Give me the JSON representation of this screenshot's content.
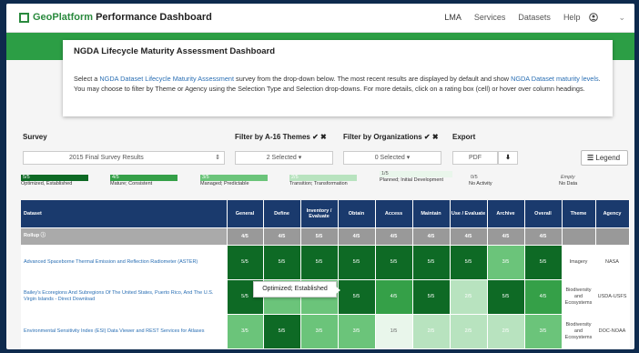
{
  "app": {
    "title_prefix": "GeoPlatform",
    "title_rest": " Performance Dashboard"
  },
  "nav": {
    "items": [
      "LMA",
      "Services",
      "Datasets",
      "Help"
    ],
    "user_caret": "⌄"
  },
  "panel": {
    "title": "NGDA Lifecycle Maturity Assessment Dashboard",
    "p1": "Select a ",
    "link1": "NGDA Dataset Lifecycle Maturity Assessment",
    "p2": " survey from the drop-down below. The most recent results are displayed by default and show ",
    "link2": "NGDA Dataset maturity levels",
    "p3": ". You may choose to filter by Theme or Agency using the Selection Type and Selection drop-downs. For more details, click on a rating box (cell) or hover over column headings."
  },
  "controls": {
    "survey_label": "Survey",
    "survey_value": "2015 Final Survey Results",
    "themes_label": "Filter by A-16 Themes",
    "themes_value": "2 Selected",
    "orgs_label": "Filter by Organizations",
    "orgs_value": "0 Selected",
    "export_label": "Export",
    "export_value": "PDF",
    "legend_button": "Legend",
    "check": "✔",
    "x": "✖",
    "caret": "▾",
    "updown": "⇕",
    "down": "⬇"
  },
  "legend": [
    {
      "score": "5/5",
      "text": "Optimized, Established",
      "color": "#0e6a25"
    },
    {
      "score": "4/5",
      "text": "Mature; Consistent",
      "color": "#35a048"
    },
    {
      "score": "3/5",
      "text": "Managed; Predictable",
      "color": "#6bc47a"
    },
    {
      "score": "2/5",
      "text": "Transition; Transformation",
      "color": "#b8e3bf"
    },
    {
      "score": "1/5",
      "text": "Planned; Initial Development",
      "color": "#e9f6eb"
    },
    {
      "score": "0/5",
      "text": "No Activity",
      "color": "#ffffff"
    },
    {
      "score": "Empty",
      "text": "No Data",
      "color": "#f5f5f5"
    }
  ],
  "table": {
    "headers": [
      "Dataset",
      "General",
      "Define",
      "Inventory / Evaluate",
      "Obtain",
      "Access",
      "Maintain",
      "Use / Evaluate",
      "Archive",
      "Overall",
      "Theme",
      "Agency"
    ],
    "rollup": {
      "name": "Rollup",
      "info": "ⓘ",
      "values": [
        "4/5",
        "4/5",
        "5/5",
        "4/5",
        "4/5",
        "4/5",
        "4/5",
        "4/5",
        "4/5"
      ]
    },
    "rows": [
      {
        "name": "Advanced Spaceborne Thermal Emission and Reflection Radiometer (ASTER)",
        "values": [
          "5/5",
          "5/5",
          "5/5",
          "5/5",
          "5/5",
          "5/5",
          "5/5",
          "3/5",
          "5/5"
        ],
        "theme": "Imagery",
        "agency": "NASA"
      },
      {
        "name": "Bailey's Ecoregions And Subregions Of The United States, Puerto Rico, And The U.S. Virgin Islands - Direct Download",
        "values": [
          "5/5",
          "3/5",
          "3/5",
          "5/5",
          "4/5",
          "5/5",
          "2/5",
          "5/5",
          "4/5"
        ],
        "theme": "Biodiversity and Ecosystems",
        "agency": "USDA-USFS"
      },
      {
        "name": "Environmental Sensitivity Index (ESI) Data Viewer and REST Services for Atlases",
        "values": [
          "3/5",
          "5/5",
          "3/5",
          "3/5",
          "1/5",
          "2/5",
          "2/5",
          "2/5",
          "3/5"
        ],
        "theme": "Biodiversity and Ecosystems",
        "agency": "DOC-NOAA"
      }
    ]
  },
  "tooltip": "Optimized; Established"
}
